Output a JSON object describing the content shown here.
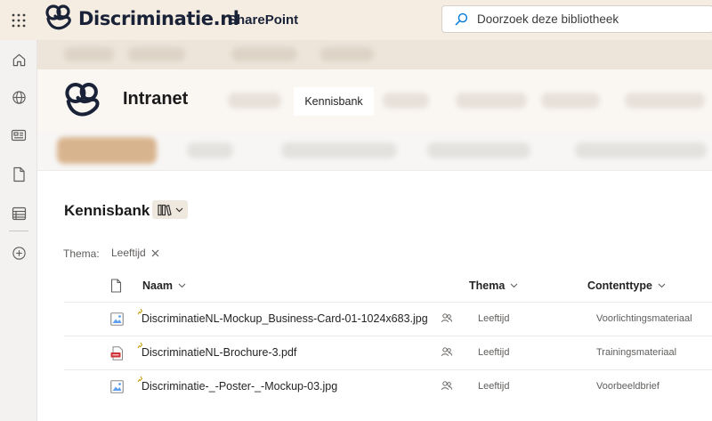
{
  "suite": {
    "brand": "Discriminatie.nl",
    "app_name": "SharePoint",
    "search_placeholder": "Doorzoek deze bibliotheek"
  },
  "appbar": {
    "items": [
      "home-icon",
      "globe-icon",
      "news-icon",
      "file-icon",
      "list-icon",
      "add-icon"
    ]
  },
  "site": {
    "title": "Intranet",
    "active_nav": "Kennisbank"
  },
  "library": {
    "title": "Kennisbank",
    "filter": {
      "label": "Thema:",
      "value": "Leeftijd"
    },
    "columns": {
      "name": "Naam",
      "thema": "Thema",
      "contenttype": "Contenttype"
    },
    "rows": [
      {
        "name": "DiscriminatieNL-Mockup_Business-Card-01-1024x683.jpg",
        "thema": "Leeftijd",
        "contenttype": "Voorlichtingsmateriaal",
        "icon": "image-file-icon"
      },
      {
        "name": "DiscriminatieNL-Brochure-3.pdf",
        "thema": "Leeftijd",
        "contenttype": "Trainingsmateriaal",
        "icon": "pdf-file-icon"
      },
      {
        "name": "Discriminatie-_-Poster-_-Mockup-03.jpg",
        "thema": "Leeftijd",
        "contenttype": "Voorbeeldbrief",
        "icon": "image-file-icon"
      }
    ]
  },
  "colors": {
    "suitebar_bg": "#f5ede2",
    "brand_navy": "#1a2238",
    "accent_blue": "#0078d4",
    "pdf_red": "#d13438"
  }
}
